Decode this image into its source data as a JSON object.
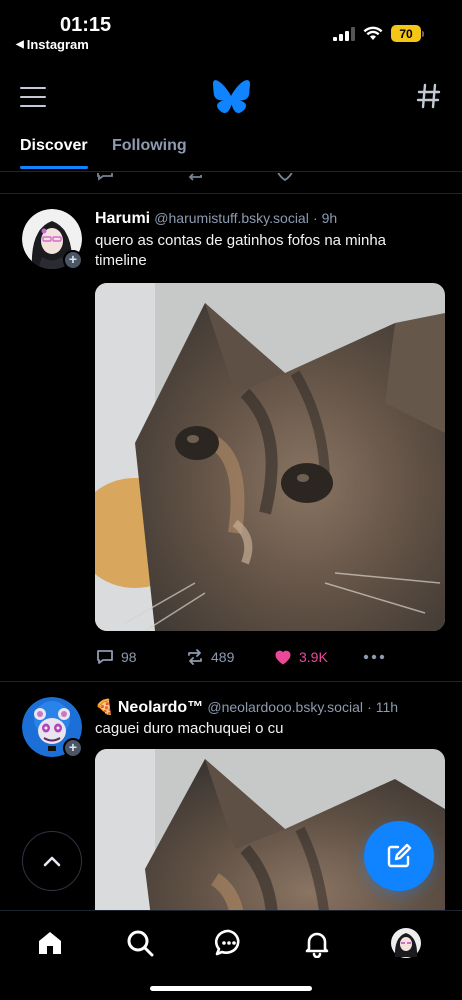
{
  "status_bar": {
    "time": "01:15",
    "back_app": "Instagram",
    "battery": "70"
  },
  "tabs": [
    {
      "label": "Discover",
      "active": true
    },
    {
      "label": "Following",
      "active": false
    }
  ],
  "posts": [
    {
      "author": "Harumi",
      "handle": "@harumistuff.bsky.social",
      "age": "9h",
      "text": "quero as contas de gatinhos fofos na minha timeline",
      "replies": "98",
      "reposts": "489",
      "likes": "3.9K",
      "liked": true
    },
    {
      "emoji": "🍕",
      "author": "Neolardo™",
      "handle": "@neolardooo.bsky.social",
      "age": "11h",
      "text": "caguei duro machuquei o cu"
    }
  ],
  "colors": {
    "accent": "#1083fe",
    "like": "#ec4899",
    "muted": "#8d9bb0",
    "background": "#000000",
    "battery": "#f5c518"
  },
  "icons": {
    "header": [
      "menu-icon",
      "butterfly-logo-icon",
      "hashtag-icon"
    ],
    "bottom_nav": [
      "home-icon",
      "search-icon",
      "chat-icon",
      "bell-icon",
      "profile-avatar"
    ],
    "floating": [
      "chevron-up-icon",
      "compose-icon"
    ]
  }
}
